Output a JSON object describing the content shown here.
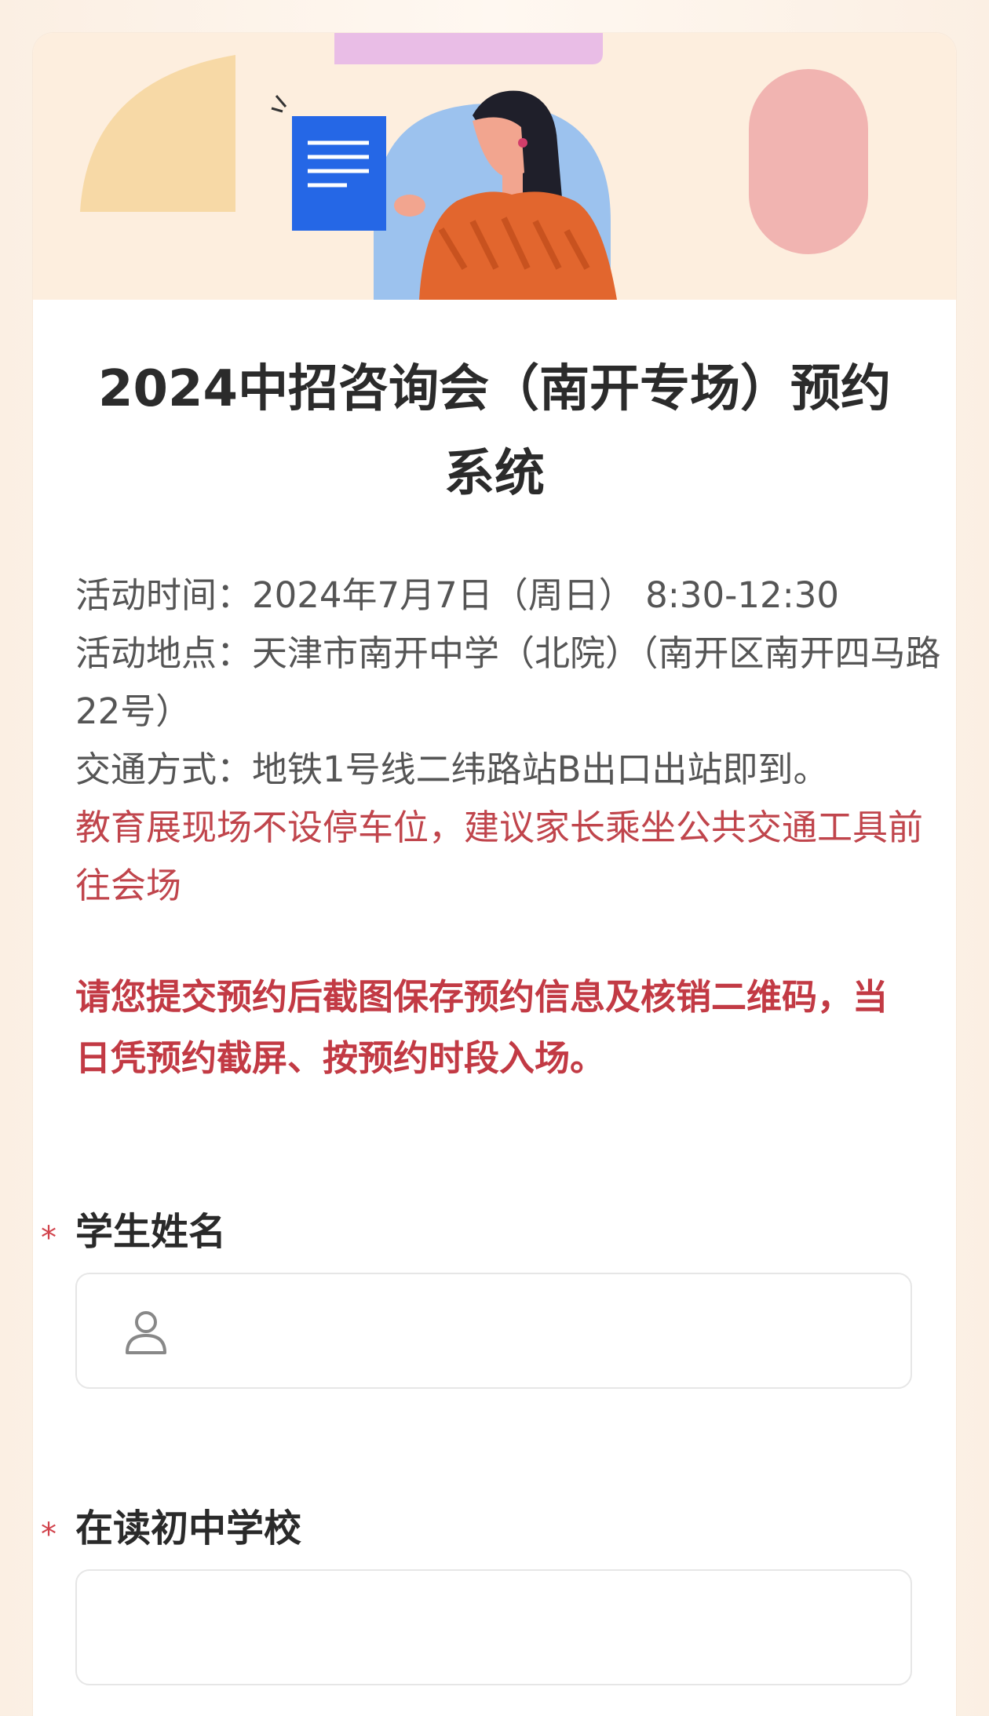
{
  "form": {
    "title": "2024中招咨询会（南开专场）预约系统",
    "info_lines": [
      "活动时间：2024年7月7日（周日） 8:30-12:30",
      "活动地点：天津市南开中学（北院）（南开区南开四马路22号）",
      "交通方式：地铁1号线二纬路站B出口出站即到。"
    ],
    "warning": "教育展现场不设停车位，建议家长乘坐公共交通工具前往会场",
    "notice": "请您提交预约后截图保存预约信息及核销二维码，当日凭预约截屏、按预约时段入场。"
  },
  "fields": [
    {
      "required_mark": "*",
      "label": "学生姓名",
      "value": "",
      "icon": "person-icon"
    },
    {
      "required_mark": "*",
      "label": "在读初中学校",
      "value": ""
    }
  ],
  "colors": {
    "warning": "#c0454c",
    "notice": "#c23a44",
    "required": "#d1434c",
    "banner_bg": "#fdeede"
  }
}
